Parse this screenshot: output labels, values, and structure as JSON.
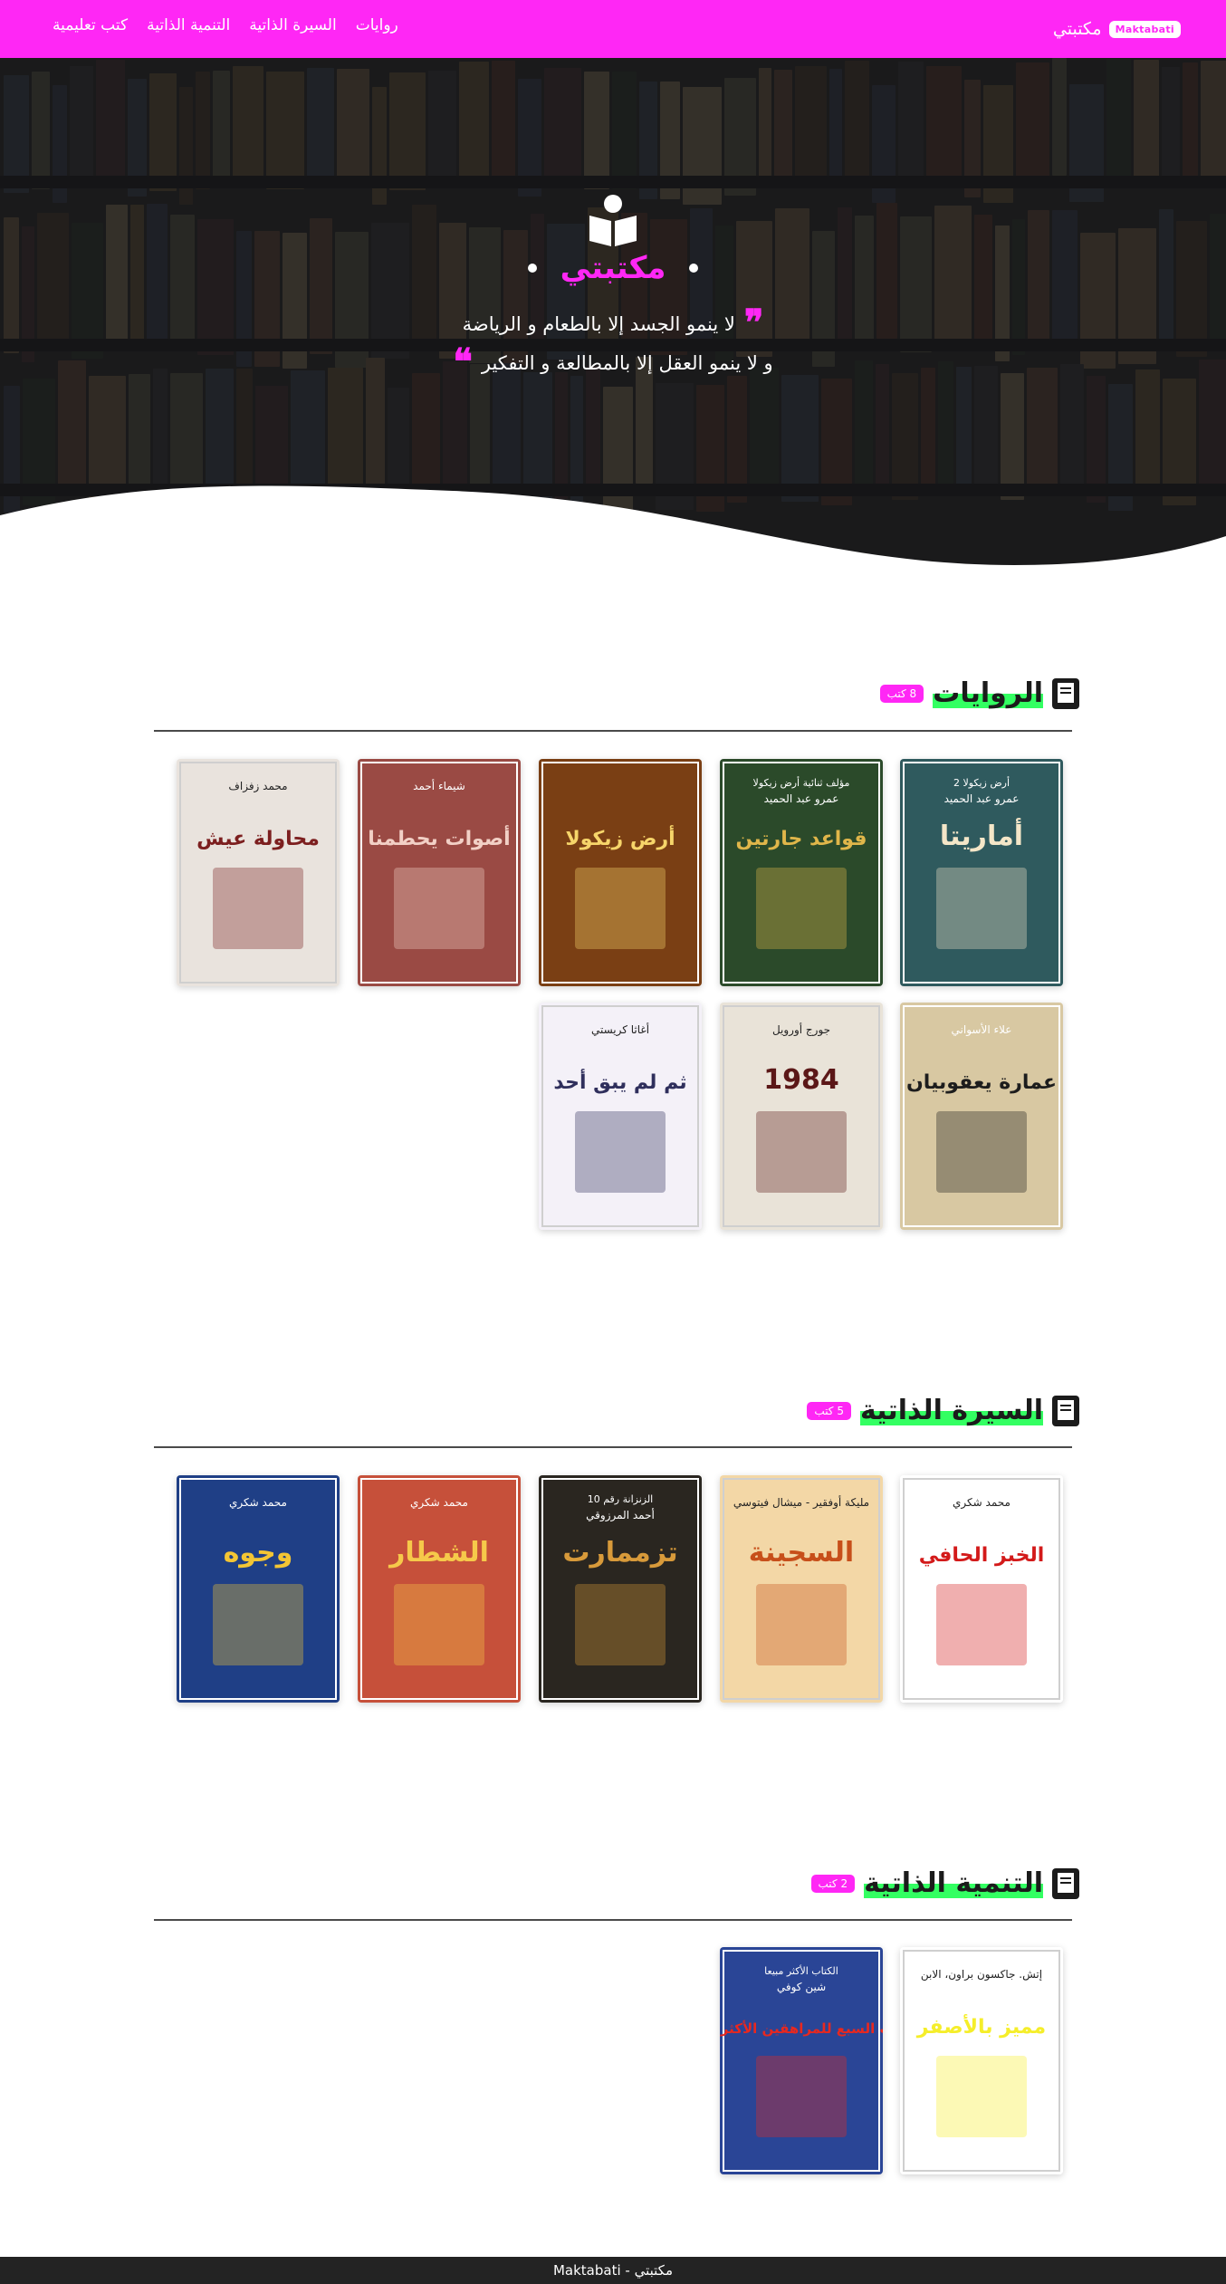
{
  "navbar": {
    "brand_text": "مكتبتي",
    "brand_badge": "Maktabati",
    "links": [
      "روايات",
      "السيرة الذاتية",
      "التنمية الذاتية",
      "كتب تعليمية"
    ]
  },
  "hero": {
    "title": "مكتبتي",
    "quote_line1": "لا ينمو الجسد إلا بالطعام و الرياضة",
    "quote_line2": "و لا ينمو العقل إلا بالمطالعة و التفكير"
  },
  "sections": [
    {
      "title": "الروايات",
      "count": "8 كتب",
      "books": [
        {
          "title": "أماريتا",
          "author": "عمرو عبد الحميد",
          "series": "أرض زيكولا 2",
          "bg": "#2f5a5e",
          "accent": "#f4e6c8"
        },
        {
          "title": "قواعد جارتين",
          "author": "عمرو عبد الحميد",
          "series": "مؤلف ثنائية أرض زيكولا",
          "bg": "#2b4a2a",
          "accent": "#e0b64a"
        },
        {
          "title": "أرض زيكولا",
          "author": "",
          "series": "",
          "bg": "#7a3f14",
          "accent": "#f6d56a"
        },
        {
          "title": "أصوات يحطمنا",
          "author": "شيماء أحمد",
          "series": "",
          "bg": "#9a4a44",
          "accent": "#f2d0c6"
        },
        {
          "title": "محاولة عيش",
          "author": "محمد زفزاف",
          "series": "",
          "bg": "#e9e3dd",
          "accent": "#7c1f1f"
        },
        {
          "title": "عمارة يعقوبيان",
          "author": "علاء الأسواني",
          "series": "",
          "bg": "#d8c8a2",
          "accent": "#1d1d1d"
        },
        {
          "title": "1984",
          "author": "جورج أورويل",
          "series": "",
          "bg": "#e9e3d8",
          "accent": "#5b1717"
        },
        {
          "title": "ثم لم يبق أحد",
          "author": "أغاثا كريستي",
          "series": "",
          "bg": "#f4f1f8",
          "accent": "#2f2f5c"
        }
      ]
    },
    {
      "title": "السيرة الذاتية",
      "count": "5 كتب",
      "books": [
        {
          "title": "الخبز الحافي",
          "author": "محمد شكري",
          "series": "",
          "bg": "#ffffff",
          "accent": "#d31a1a"
        },
        {
          "title": "السجينة",
          "author": "مليكة أوفقير - ميشال فيتوسي",
          "series": "",
          "bg": "#f3d7a6",
          "accent": "#c74f1a"
        },
        {
          "title": "تزممارت",
          "author": "أحمد المرزوقي",
          "series": "الزنزانة رقم 10",
          "bg": "#2a2620",
          "accent": "#d89a3a"
        },
        {
          "title": "الشطار",
          "author": "محمد شكري",
          "series": "",
          "bg": "#c6503a",
          "accent": "#f6c94a"
        },
        {
          "title": "وجوه",
          "author": "محمد شكري",
          "series": "",
          "bg": "#1f3f86",
          "accent": "#f3c534"
        }
      ]
    },
    {
      "title": "التنمية الذاتية",
      "count": "2 كتب",
      "books": [
        {
          "title": "مميز بالأصفر",
          "author": "إتش. جاكسون براون، الابن",
          "series": "",
          "bg": "#ffffff",
          "accent": "#f5ee2a"
        },
        {
          "title": "العادات السبع للمراهقين الأكثر فعالية",
          "author": "شين كوفي",
          "series": "الكتاب الأكثر مبيعا",
          "bg": "#2a4596",
          "accent": "#e8281f"
        }
      ]
    }
  ],
  "footer": {
    "text": "Maktabati - مكتبتي"
  }
}
